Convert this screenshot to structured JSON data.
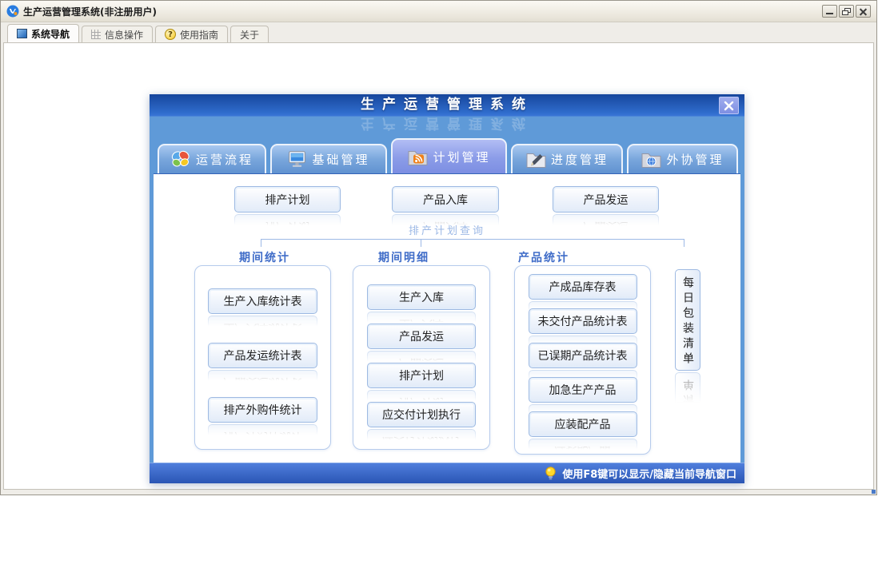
{
  "window": {
    "title": "生产运营管理系统(非注册用户)"
  },
  "main_tabs": [
    {
      "label": "系统导航",
      "icon": "nav-square",
      "active": true
    },
    {
      "label": "信息操作",
      "icon": "grid",
      "active": false
    },
    {
      "label": "使用指南",
      "icon": "help",
      "active": false
    },
    {
      "label": "关于",
      "icon": "",
      "active": false
    }
  ],
  "icons": {
    "help_glyph": "?"
  },
  "dialog": {
    "title": "生产运营管理系统",
    "tabs": [
      {
        "label": "运营流程",
        "icon": "butterfly",
        "active": false
      },
      {
        "label": "基础管理",
        "icon": "monitor",
        "active": false
      },
      {
        "label": "计划管理",
        "icon": "folder-rss",
        "active": true
      },
      {
        "label": "进度管理",
        "icon": "folder-pencil",
        "active": false
      },
      {
        "label": "外协管理",
        "icon": "folder-globe",
        "active": false
      }
    ],
    "top_buttons": [
      "排产计划",
      "产品入库",
      "产品发运"
    ],
    "query_label": "排产计划查询",
    "columns": [
      {
        "header": "期间统计",
        "buttons": [
          "生产入库统计表",
          "产品发运统计表",
          "排产外购件统计"
        ]
      },
      {
        "header": "期间明细",
        "buttons": [
          "生产入库",
          "产品发运",
          "排产计划",
          "应交付计划执行"
        ]
      },
      {
        "header": "产品统计",
        "buttons": [
          "产成品库存表",
          "未交付产品统计表",
          "已误期产品统计表",
          "加急生产产品",
          "应装配产品"
        ]
      }
    ],
    "side_button": "每日包装清单",
    "status_text": "使用F8键可以显示/隐藏当前导航窗口"
  },
  "colors": {
    "dialog_header_blue": "#1c4fa6",
    "dialog_band_blue": "#5f9ad8",
    "active_tab_periwinkle": "#8b9ce8",
    "status_bar_blue": "#2f5cbc",
    "button_border_blue": "#9db9e2",
    "label_blue": "#3f6cc8"
  }
}
